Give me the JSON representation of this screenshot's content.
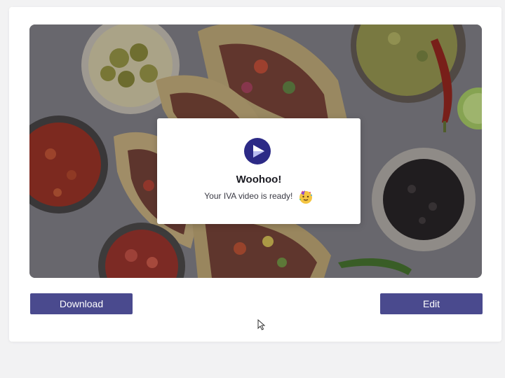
{
  "modal": {
    "title": "Woohoo!",
    "message": "Your IVA video is ready!",
    "logo_icon": "play-logo-icon",
    "emoji_icon": "party-face-icon"
  },
  "actions": {
    "download_label": "Download",
    "edit_label": "Edit"
  },
  "preview": {
    "image_icon": "video-thumbnail-image"
  },
  "colors": {
    "accent": "#4a4a8e",
    "logo": "#2c2a86",
    "background": "#f2f2f3",
    "card": "#ffffff"
  }
}
